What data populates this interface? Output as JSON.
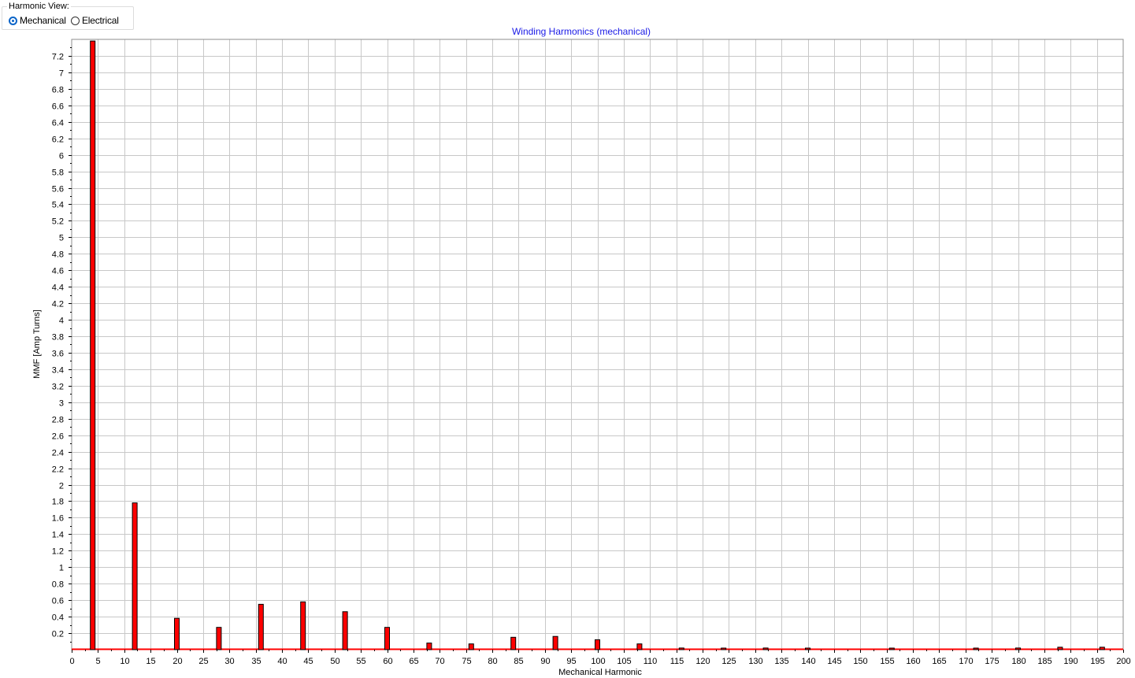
{
  "controls": {
    "harmonic_view_label": "Harmonic View:",
    "options": [
      {
        "label": "Mechanical",
        "selected": true
      },
      {
        "label": "Electrical",
        "selected": false
      }
    ]
  },
  "chart_data": {
    "type": "bar",
    "title": "Winding Harmonics (mechanical)",
    "xlabel": "Mechanical Harmonic",
    "ylabel": "MMF [Amp Turns]",
    "xlim": [
      0,
      200
    ],
    "ylim": [
      0,
      7.4
    ],
    "x_ticks": [
      0,
      5,
      10,
      15,
      20,
      25,
      30,
      35,
      40,
      45,
      50,
      55,
      60,
      65,
      70,
      75,
      80,
      85,
      90,
      95,
      100,
      105,
      110,
      115,
      120,
      125,
      130,
      135,
      140,
      145,
      150,
      155,
      160,
      165,
      170,
      175,
      180,
      185,
      190,
      195,
      200
    ],
    "y_ticks": [
      0.2,
      0.4,
      0.6,
      0.8,
      1,
      1.2,
      1.4,
      1.6,
      1.8,
      2,
      2.2,
      2.4,
      2.6,
      2.8,
      3,
      3.2,
      3.4,
      3.6,
      3.8,
      4,
      4.2,
      4.4,
      4.6,
      4.8,
      5,
      5.2,
      5.4,
      5.6,
      5.8,
      6,
      6.2,
      6.4,
      6.6,
      6.8,
      7,
      7.2
    ],
    "grid": true,
    "bar_color": "#ff0000",
    "bar_edge_color": "#000000",
    "baseline_color": "#ff0000",
    "title_color": "#1a1ae6",
    "grid_color": "#c8c8c8",
    "x": [
      4,
      12,
      20,
      28,
      36,
      44,
      52,
      60,
      68,
      76,
      84,
      92,
      100,
      108,
      116,
      124,
      132,
      140,
      148,
      156,
      164,
      172,
      180,
      188,
      196
    ],
    "values": [
      7.38,
      1.78,
      0.38,
      0.27,
      0.55,
      0.58,
      0.46,
      0.27,
      0.08,
      0.07,
      0.15,
      0.16,
      0.12,
      0.07,
      0.02,
      0.01,
      0.02,
      0.01,
      0.0,
      0.01,
      0.0,
      0.01,
      0.02,
      0.03,
      0.03
    ]
  }
}
